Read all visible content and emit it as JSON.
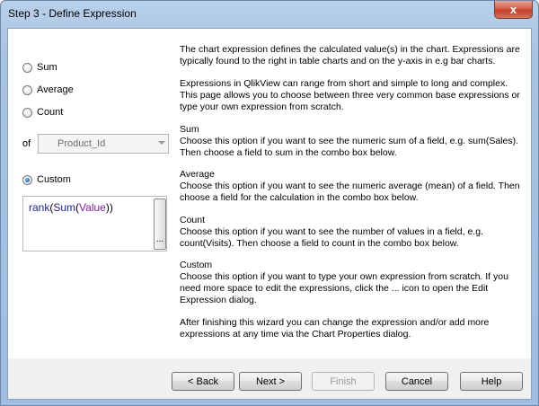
{
  "window": {
    "title": "Step 3 - Define Expression",
    "close_glyph": "x"
  },
  "options": {
    "sum_label": "Sum",
    "average_label": "Average",
    "count_label": "Count",
    "of_label": "of",
    "field_value": "Product_Id",
    "custom_label": "Custom",
    "selected": "custom"
  },
  "expression": {
    "fn_outer": "rank",
    "p1": "(",
    "fn_inner": "Sum",
    "p2": "(",
    "field": "Value",
    "p3": "))",
    "ellipsis": "..."
  },
  "description": {
    "intro": "The chart expression defines the calculated value(s) in the chart. Expressions are typically found to the right in table charts and on the y-axis in e.g bar charts.",
    "range": "Expressions in QlikView can range from short and simple to long and complex. This page allows you to choose between three very common base expressions or type your own expression from scratch.",
    "sum_title": "Sum",
    "sum_text": "Choose this option if you want to see the numeric sum of a field, e.g. sum(Sales). Then choose a field to sum in the combo box below.",
    "average_title": "Average",
    "average_text": "Choose this option if you want to see the numeric average (mean) of a field. Then choose a field for the calculation in the combo box below.",
    "count_title": "Count",
    "count_text": "Choose this option if you want to see the number of values in a field, e.g. count(Visits). Then choose a field to count in the combo box below.",
    "custom_title": "Custom",
    "custom_text": "Choose this option if you want to type your own expression from scratch. If you need more space to edit the expressions, click the ... icon to open the Edit Expression dialog.",
    "outro": "After finishing this wizard you can change the expression and/or add more expressions at any time via the Chart Properties dialog."
  },
  "buttons": {
    "back": "< Back",
    "next": "Next >",
    "finish": "Finish",
    "cancel": "Cancel",
    "help": "Help"
  }
}
